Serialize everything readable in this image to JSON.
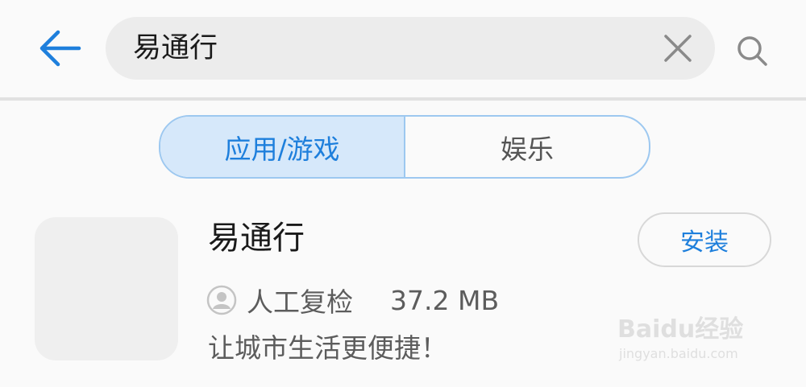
{
  "header": {
    "back_icon": "arrow-left-icon",
    "search": {
      "query": "易通行",
      "clear_icon": "close-icon"
    },
    "search_icon": "magnifier-icon"
  },
  "tabs": [
    {
      "label": "应用/游戏",
      "active": true
    },
    {
      "label": "娱乐",
      "active": false
    }
  ],
  "app": {
    "name": "易通行",
    "review_icon": "user-avatar-icon",
    "review_label": "人工复检",
    "size": "37.2 MB",
    "description": "让城市生活更便捷！",
    "install_label": "安装"
  },
  "watermark": {
    "logo": "Baidu经验",
    "url": "jingyan.baidu.com"
  },
  "colors": {
    "accent": "#1e7fdc",
    "tab_active_bg": "#d6e8fa",
    "tab_border": "#9dc8f0",
    "background": "#fafafa",
    "search_bg": "#ececec"
  }
}
